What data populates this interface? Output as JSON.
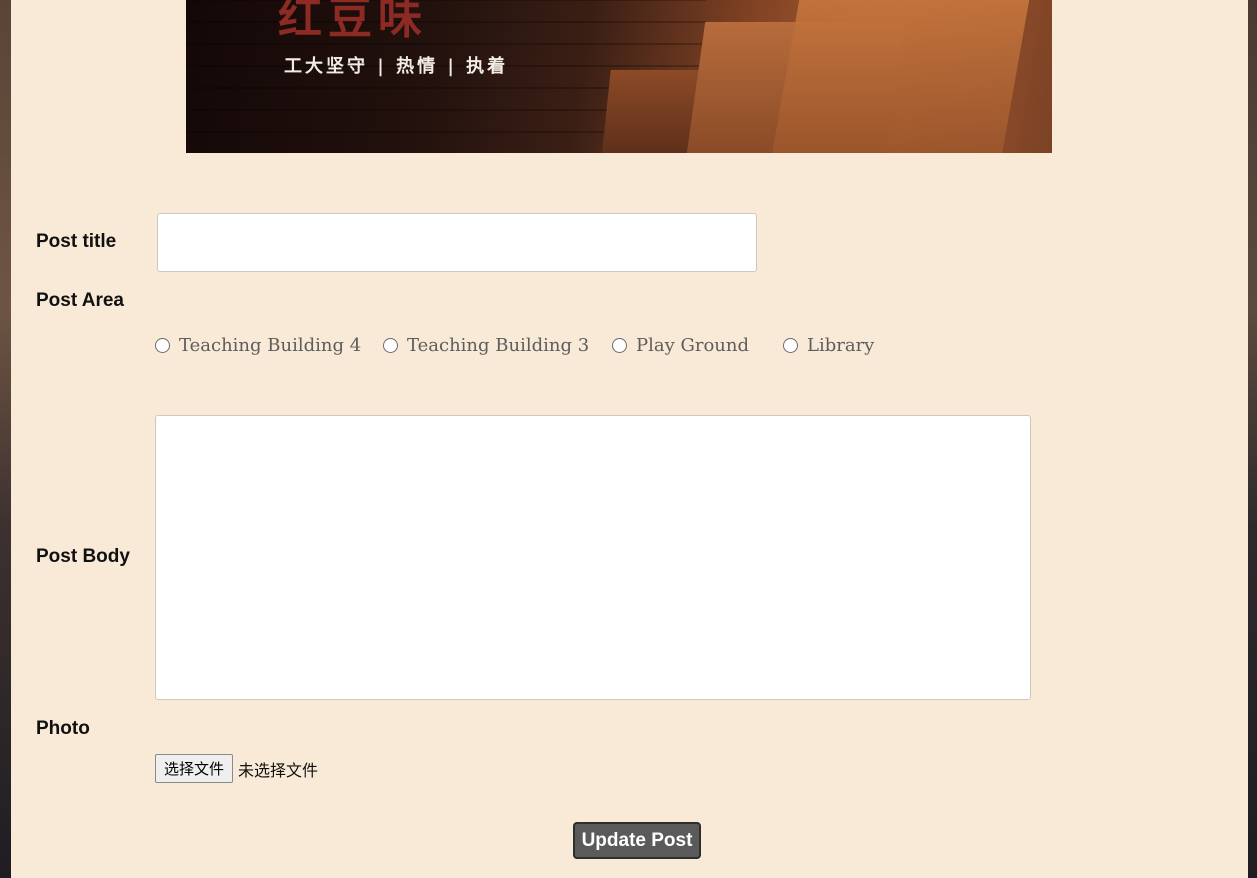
{
  "banner": {
    "title": "红豆味",
    "subtitle": "工大坚守 | 热情 | 执着"
  },
  "form": {
    "post_title": {
      "label": "Post title",
      "value": ""
    },
    "post_area": {
      "label": "Post Area",
      "options": [
        "Teaching Building 4",
        "Teaching Building 3",
        "Play Ground",
        "Library"
      ]
    },
    "post_body": {
      "label": "Post Body",
      "value": ""
    },
    "photo": {
      "label": "Photo",
      "choose_button": "选择文件",
      "status": "未选择文件"
    },
    "submit_label": "Update Post"
  },
  "colors": {
    "panel_bg": "#f9ead7",
    "button_bg": "#5a5a5a"
  }
}
